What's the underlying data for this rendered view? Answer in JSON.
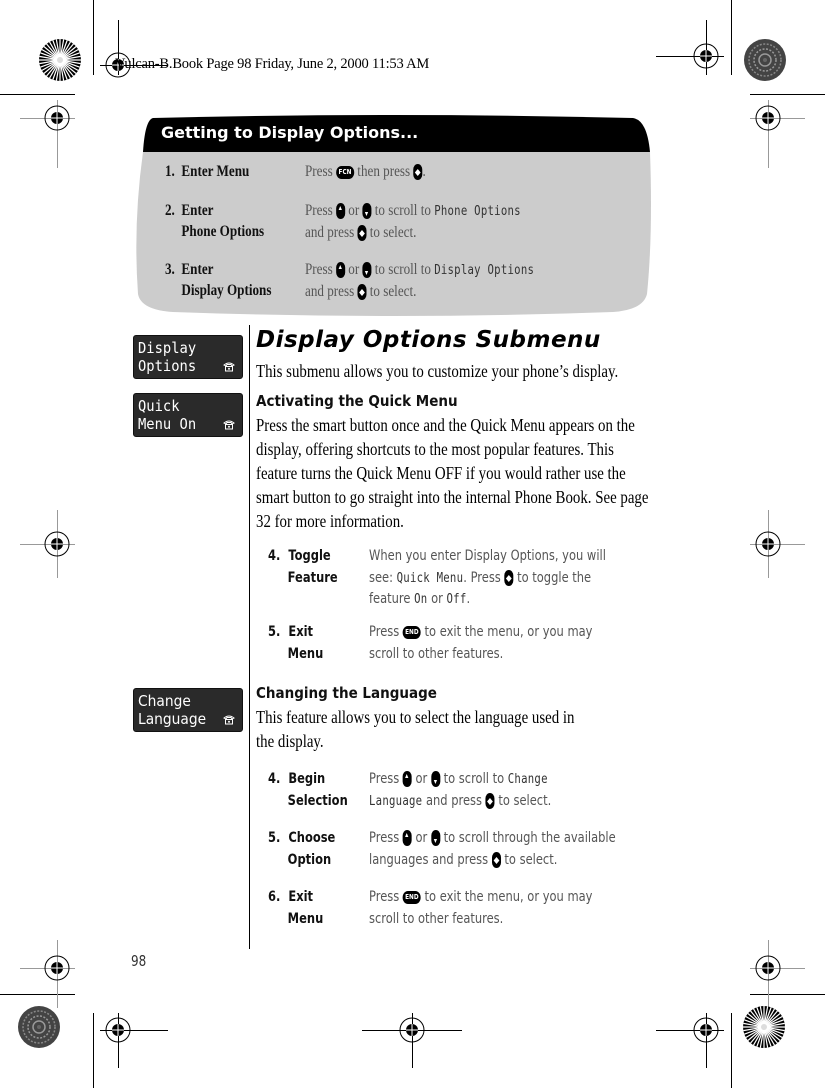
{
  "slug": "Vulcan-B.Book  Page 98  Friday, June 2, 2000  11:53 AM",
  "page_number": "98",
  "getting_to": {
    "title": "Getting to Display Options...",
    "steps": [
      {
        "num": "1.",
        "label_lines": [
          "Enter Menu"
        ],
        "desc": {
          "pre": "Press ",
          "key1": "FCN",
          "mid": " then press ",
          "post": "."
        }
      },
      {
        "num": "2.",
        "label_lines": [
          "Enter",
          "Phone Options"
        ],
        "desc": {
          "l1_pre": "Press ",
          "l1_or": " or ",
          "l1_post": " to scroll to ",
          "lcd": "Phone Options",
          "l2_pre": "and press ",
          "l2_post": " to select."
        }
      },
      {
        "num": "3.",
        "label_lines": [
          "Enter",
          "Display Options"
        ],
        "desc": {
          "l1_pre": "Press ",
          "l1_or": " or ",
          "l1_post": " to scroll to ",
          "lcd": "Display Options",
          "l2_pre": "and press ",
          "l2_post": " to select."
        }
      }
    ]
  },
  "screens": [
    {
      "line1": "Display",
      "line2": "Options",
      "icon": "phone-icon"
    },
    {
      "line1": "Quick",
      "line2": "Menu On",
      "icon": "phone-icon"
    },
    {
      "line1": "Change",
      "line2": "Language",
      "icon": "phone-icon"
    }
  ],
  "main": {
    "title": "Display Options Submenu",
    "intro": "This submenu allows you to customize your phone’s display.",
    "quick_menu": {
      "heading": "Activating the Quick Menu",
      "body": "Press the smart button once and the Quick Menu appears on the display, offering shortcuts to the most popular features. This feature turns the Quick Menu OFF if you would rather use the smart button to go straight into the internal Phone Book. See page 32 for more information.",
      "steps": [
        {
          "num": "4.",
          "label1": "Toggle",
          "label2": "Feature",
          "l1": "When you enter Display Options, you will",
          "l2_pre": "see: ",
          "l2_lcd": "Quick Menu",
          "l2_mid": ". Press ",
          "l2_post": " to toggle the",
          "l3_pre": "feature ",
          "l3_lcd1": "On",
          "l3_mid": " or ",
          "l3_lcd2": "Off",
          "l3_post": "."
        },
        {
          "num": "5.",
          "label1": "Exit",
          "label2": "Menu",
          "l1_pre": "Press ",
          "key": "END",
          "l1_post": " to exit the menu, or you may",
          "l2": "scroll to other features."
        }
      ]
    },
    "language": {
      "heading": "Changing the Language",
      "body_l1": "This feature allows you to select the language used in",
      "body_l2": "the display.",
      "steps": [
        {
          "num": "4.",
          "label1": "Begin",
          "label2": "Selection",
          "l1_pre": "Press ",
          "l1_or": " or ",
          "l1_post": " to scroll to ",
          "l1_lcd": "Change",
          "l2_lcd": "Language",
          "l2_mid": " and press ",
          "l2_post": " to select."
        },
        {
          "num": "5.",
          "label1": "Choose",
          "label2": "Option",
          "l1_pre": "Press ",
          "l1_or": " or ",
          "l1_post": " to scroll through the available",
          "l2_pre": "languages and press ",
          "l2_post": " to select."
        },
        {
          "num": "6.",
          "label1": "Exit",
          "label2": "Menu",
          "l1_pre": "Press ",
          "key": "END",
          "l1_post": " to exit the menu, or you may",
          "l2": "scroll to other features."
        }
      ]
    }
  },
  "keys": {
    "fcn": "FCN",
    "end": "END"
  },
  "colors": {
    "panel_gray": "#cccccc",
    "panel_header": "#000000",
    "lcd_bg": "#2a2a2a"
  }
}
